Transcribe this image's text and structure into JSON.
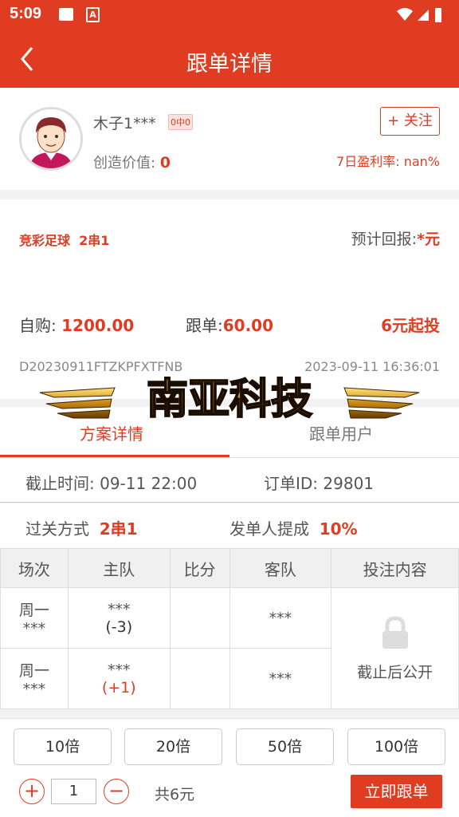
{
  "status": {
    "time": "5:09",
    "icon2_label": "A"
  },
  "nav": {
    "title": "跟单详情"
  },
  "user": {
    "name": "木子1***",
    "badge": "0中0",
    "value_label": "创造价值: ",
    "value": "0",
    "follow_label": "+ 关注",
    "rate": "7日盈利率: nan%"
  },
  "plan": {
    "type_label": "竞彩足球",
    "type_value": "2串1",
    "return_label": "预计回报:",
    "return_value": "*元",
    "self_label": "自购: ",
    "self_value": "1200.00",
    "follow_label": "跟单:",
    "follow_value": "60.00",
    "min_invest": "6元起投",
    "order_code": "D20230911FTZKPFXTFNB",
    "datetime": "2023-09-11 16:36:01"
  },
  "watermark": "南亚科技",
  "tabs": [
    {
      "label": "方案详情"
    },
    {
      "label": "跟单用户"
    }
  ],
  "details": {
    "deadline": "截止时间: 09-11 22:00",
    "order_id": "订单ID: 29801",
    "pass_label": "过关方式",
    "pass_value": "2串1",
    "commission_label": "发单人提成",
    "commission_value": "10%"
  },
  "table": {
    "headers": [
      "场次",
      "主队",
      "比分",
      "客队",
      "投注内容"
    ],
    "rows": [
      {
        "session_day": "周一",
        "session_no": "***",
        "home": "***",
        "handicap": "(-3)",
        "score": "",
        "away": "***"
      },
      {
        "session_day": "周一",
        "session_no": "***",
        "home": "***",
        "handicap": "(+1)",
        "score": "",
        "away": "***"
      }
    ],
    "bet_content": "截止后公开"
  },
  "bottom": {
    "multipliers": [
      "10倍",
      "20倍",
      "50倍",
      "100倍"
    ],
    "quantity": "1",
    "total": "共6元",
    "submit": "立即跟单"
  },
  "colors": {
    "primary": "#e03c22"
  }
}
